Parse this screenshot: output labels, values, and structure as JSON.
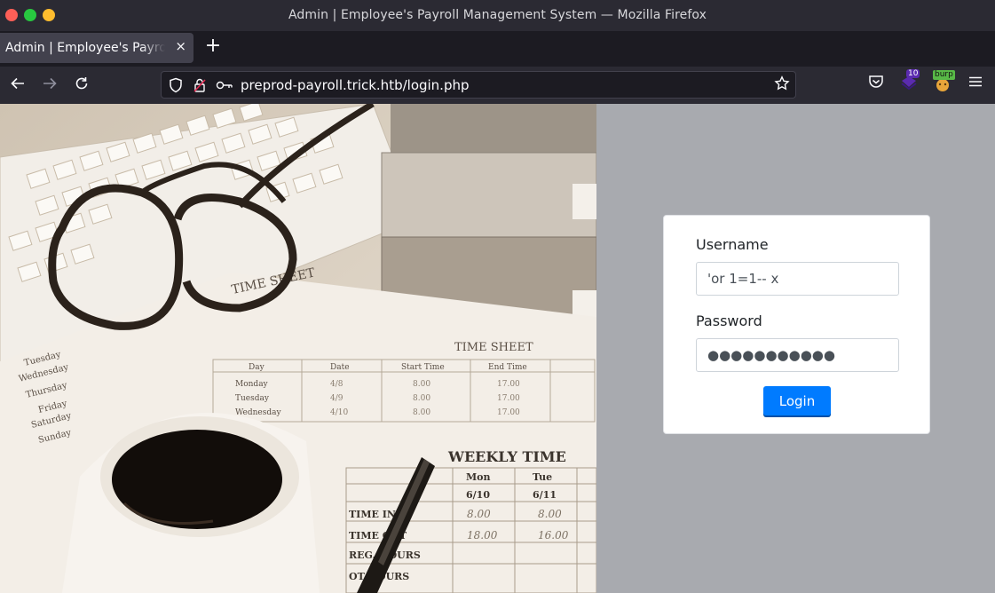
{
  "window": {
    "title": "Admin | Employee's Payroll Management System — Mozilla Firefox"
  },
  "tabs": [
    {
      "label": "Admin | Employee's Payroll Management System",
      "close_icon": "×"
    }
  ],
  "new_tab_icon": "+",
  "nav": {
    "url": "preprod-payroll.trick.htb/login.php",
    "extension_badge": "10",
    "burp_label": "burp"
  },
  "hero_image": {
    "timesheet_heading": "TIME SHEET",
    "weekly_heading": "WEEKLY TIME",
    "columns": [
      "Day",
      "Date",
      "Start Time",
      "End Time"
    ],
    "rows": [
      [
        "Monday",
        "4/8",
        "8.00",
        "17.00"
      ],
      [
        "Tuesday",
        "4/9",
        "8.00",
        "17.00"
      ],
      [
        "Wednesday",
        "4/10",
        "8.00",
        "17.00"
      ]
    ],
    "weekly_cols": [
      "Mon",
      "Tue"
    ],
    "weekly_dates": [
      "6/10",
      "6/11"
    ],
    "weekly_start": [
      "8.00",
      "8.00"
    ],
    "weekly_end": [
      "18.00",
      "16.00"
    ],
    "weekly_rows": [
      "TIME IN",
      "TIME OUT",
      "REG. HOURS",
      "OT HOURS"
    ],
    "days": [
      "Tuesday",
      "Wednesday",
      "Thursday",
      "Friday",
      "Saturday",
      "Sunday"
    ]
  },
  "login": {
    "username_label": "Username",
    "username_value": "'or 1=1-- x",
    "password_label": "Password",
    "password_value": "●●●●●●●●●●●",
    "button_label": "Login"
  },
  "colors": {
    "primary": "#007bff",
    "right_pane": "#a8aaaf",
    "chrome": "#2b2a33"
  }
}
